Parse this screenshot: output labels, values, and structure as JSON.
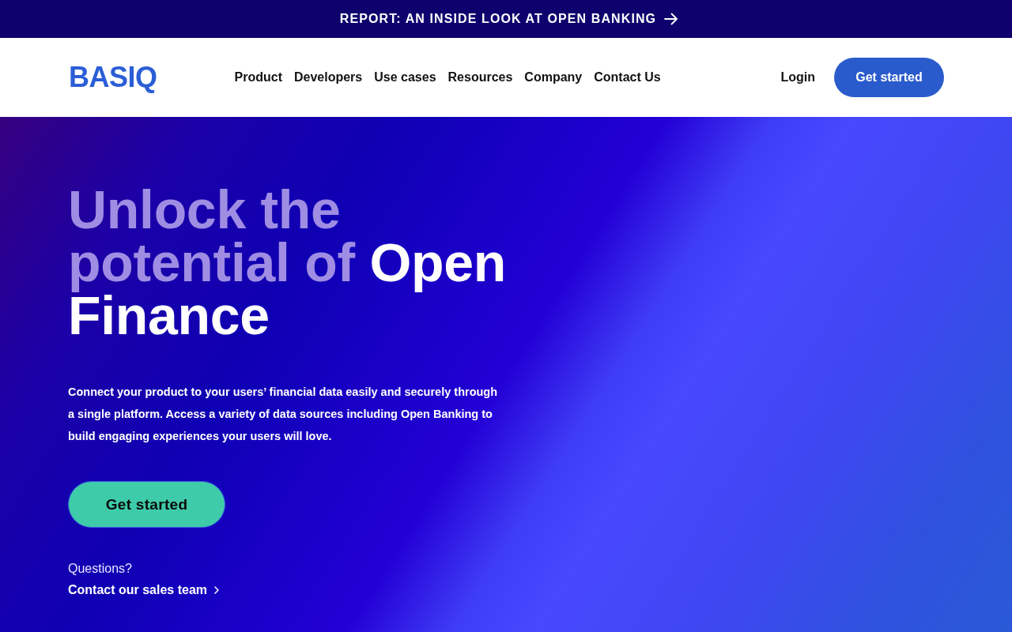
{
  "announcement": {
    "text": "REPORT: AN INSIDE LOOK AT OPEN BANKING"
  },
  "header": {
    "logo": "BASIQ",
    "nav": [
      "Product",
      "Developers",
      "Use cases",
      "Resources",
      "Company",
      "Contact Us"
    ],
    "login": "Login",
    "cta": "Get started"
  },
  "hero": {
    "heading": {
      "muted": "Unlock the potential of",
      "highlight": "Open Finance"
    },
    "description": "Connect your product to your users’ financial data easily and securely through a single platform. Access a variety of data sources including Open Banking to build engaging experiences your users will love.",
    "cta": "Get started",
    "question": "Questions?",
    "contact_link": "Contact our sales team"
  }
}
